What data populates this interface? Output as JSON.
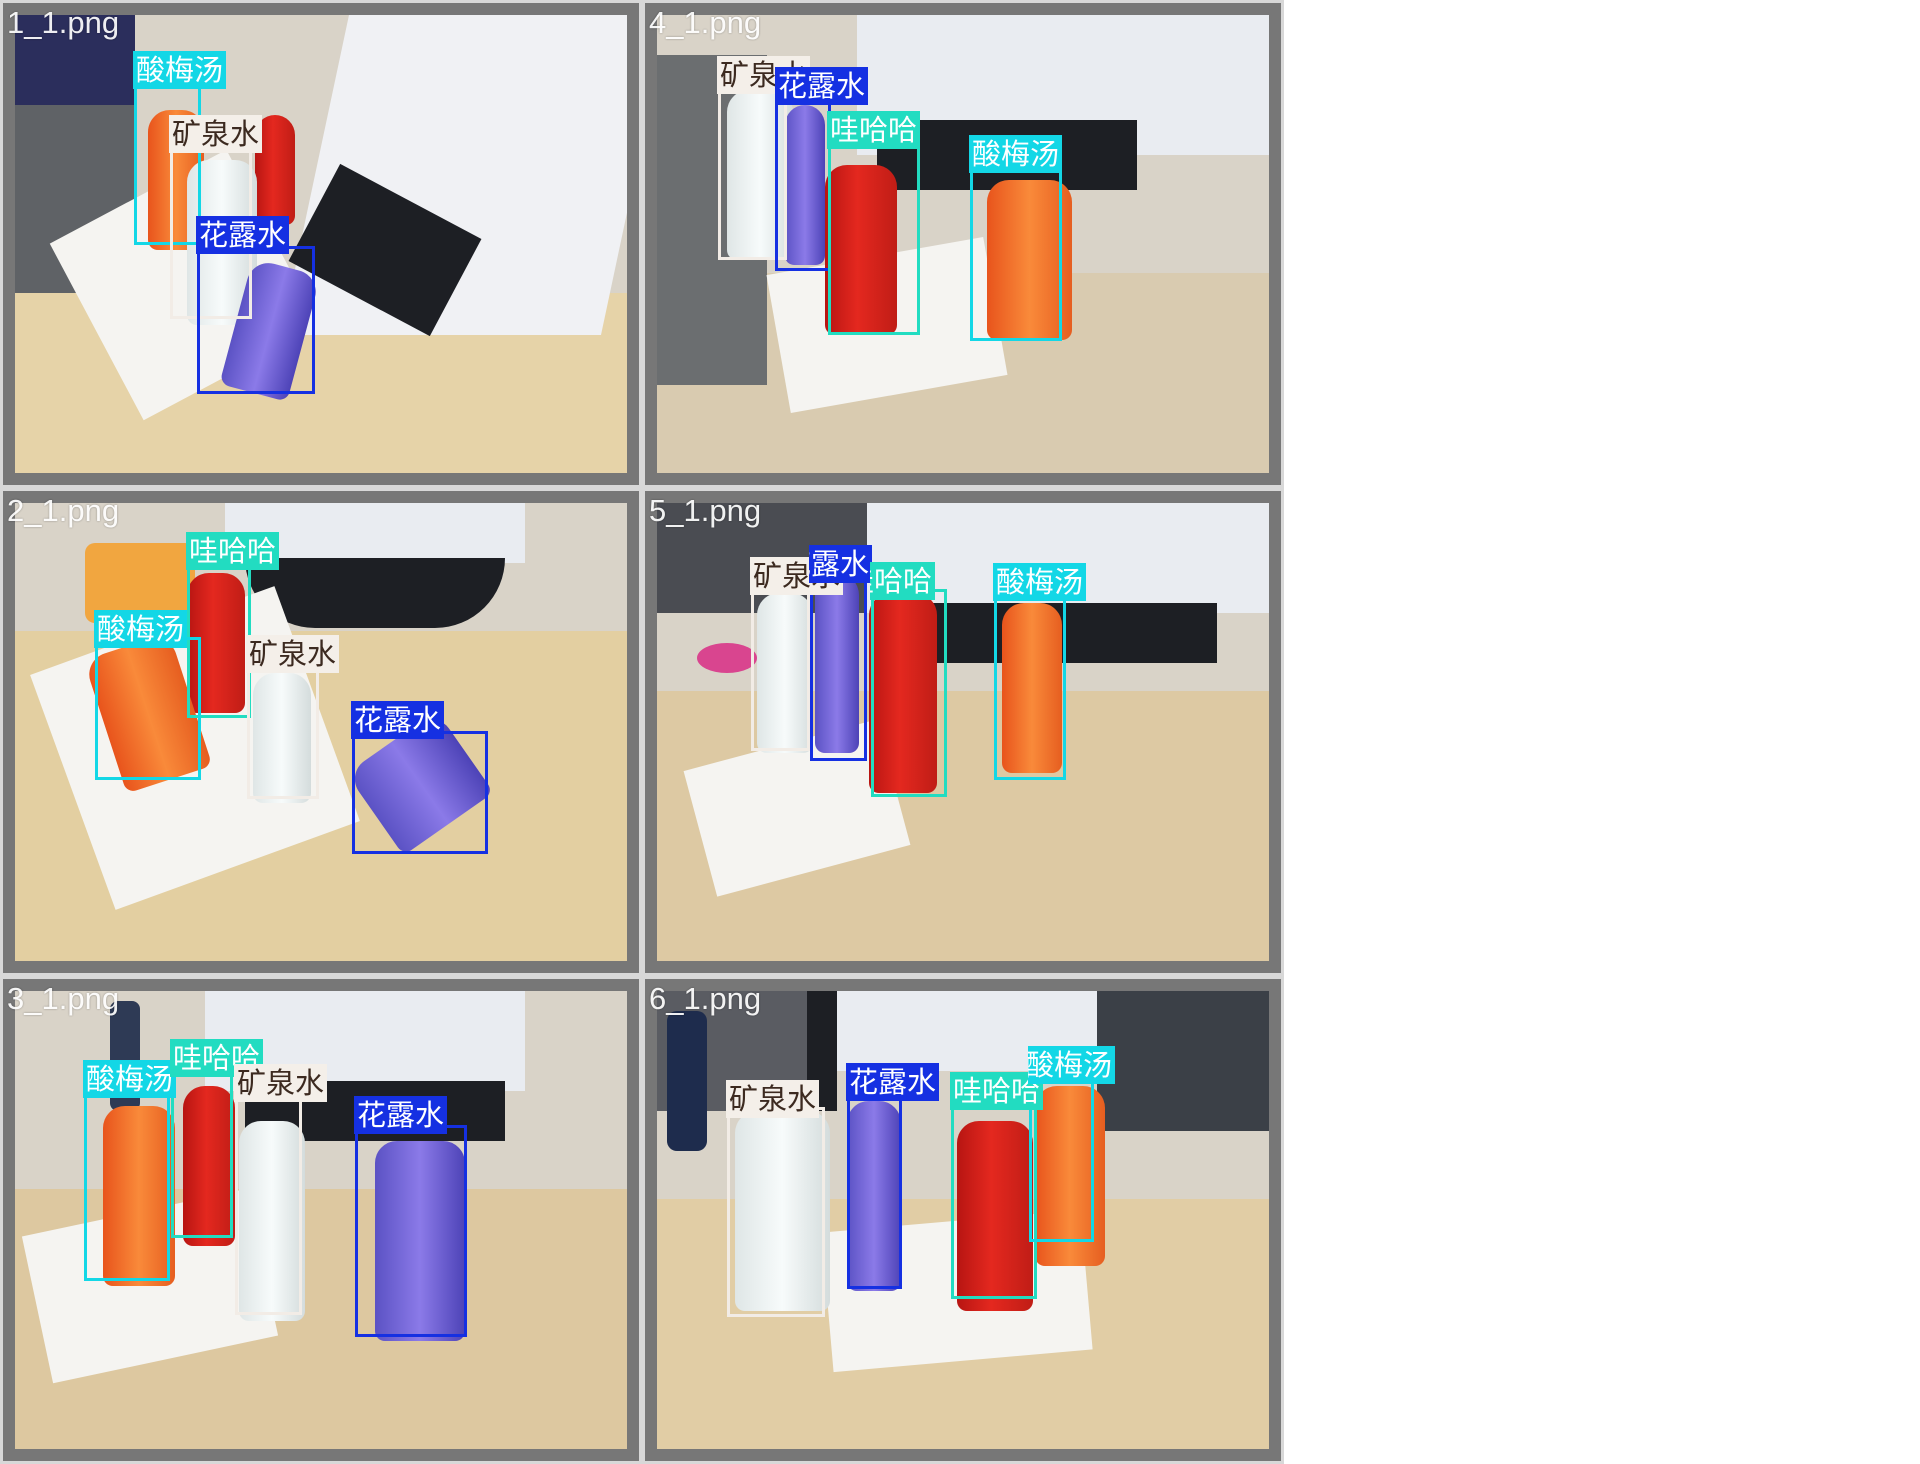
{
  "classes": {
    "sour": "酸梅汤",
    "water": "矿泉水",
    "flower": "花露水",
    "wow": "哇哈哈"
  },
  "colors": {
    "sour": "#13d7e6",
    "water": "#f2ece6",
    "flower": "#1530e2",
    "wow": "#22dcc1"
  },
  "tiles": [
    {
      "file": "1_1.png"
    },
    {
      "file": "4_1.png"
    },
    {
      "file": "2_1.png"
    },
    {
      "file": "5_1.png"
    },
    {
      "file": "3_1.png"
    },
    {
      "file": "6_1.png"
    }
  ]
}
